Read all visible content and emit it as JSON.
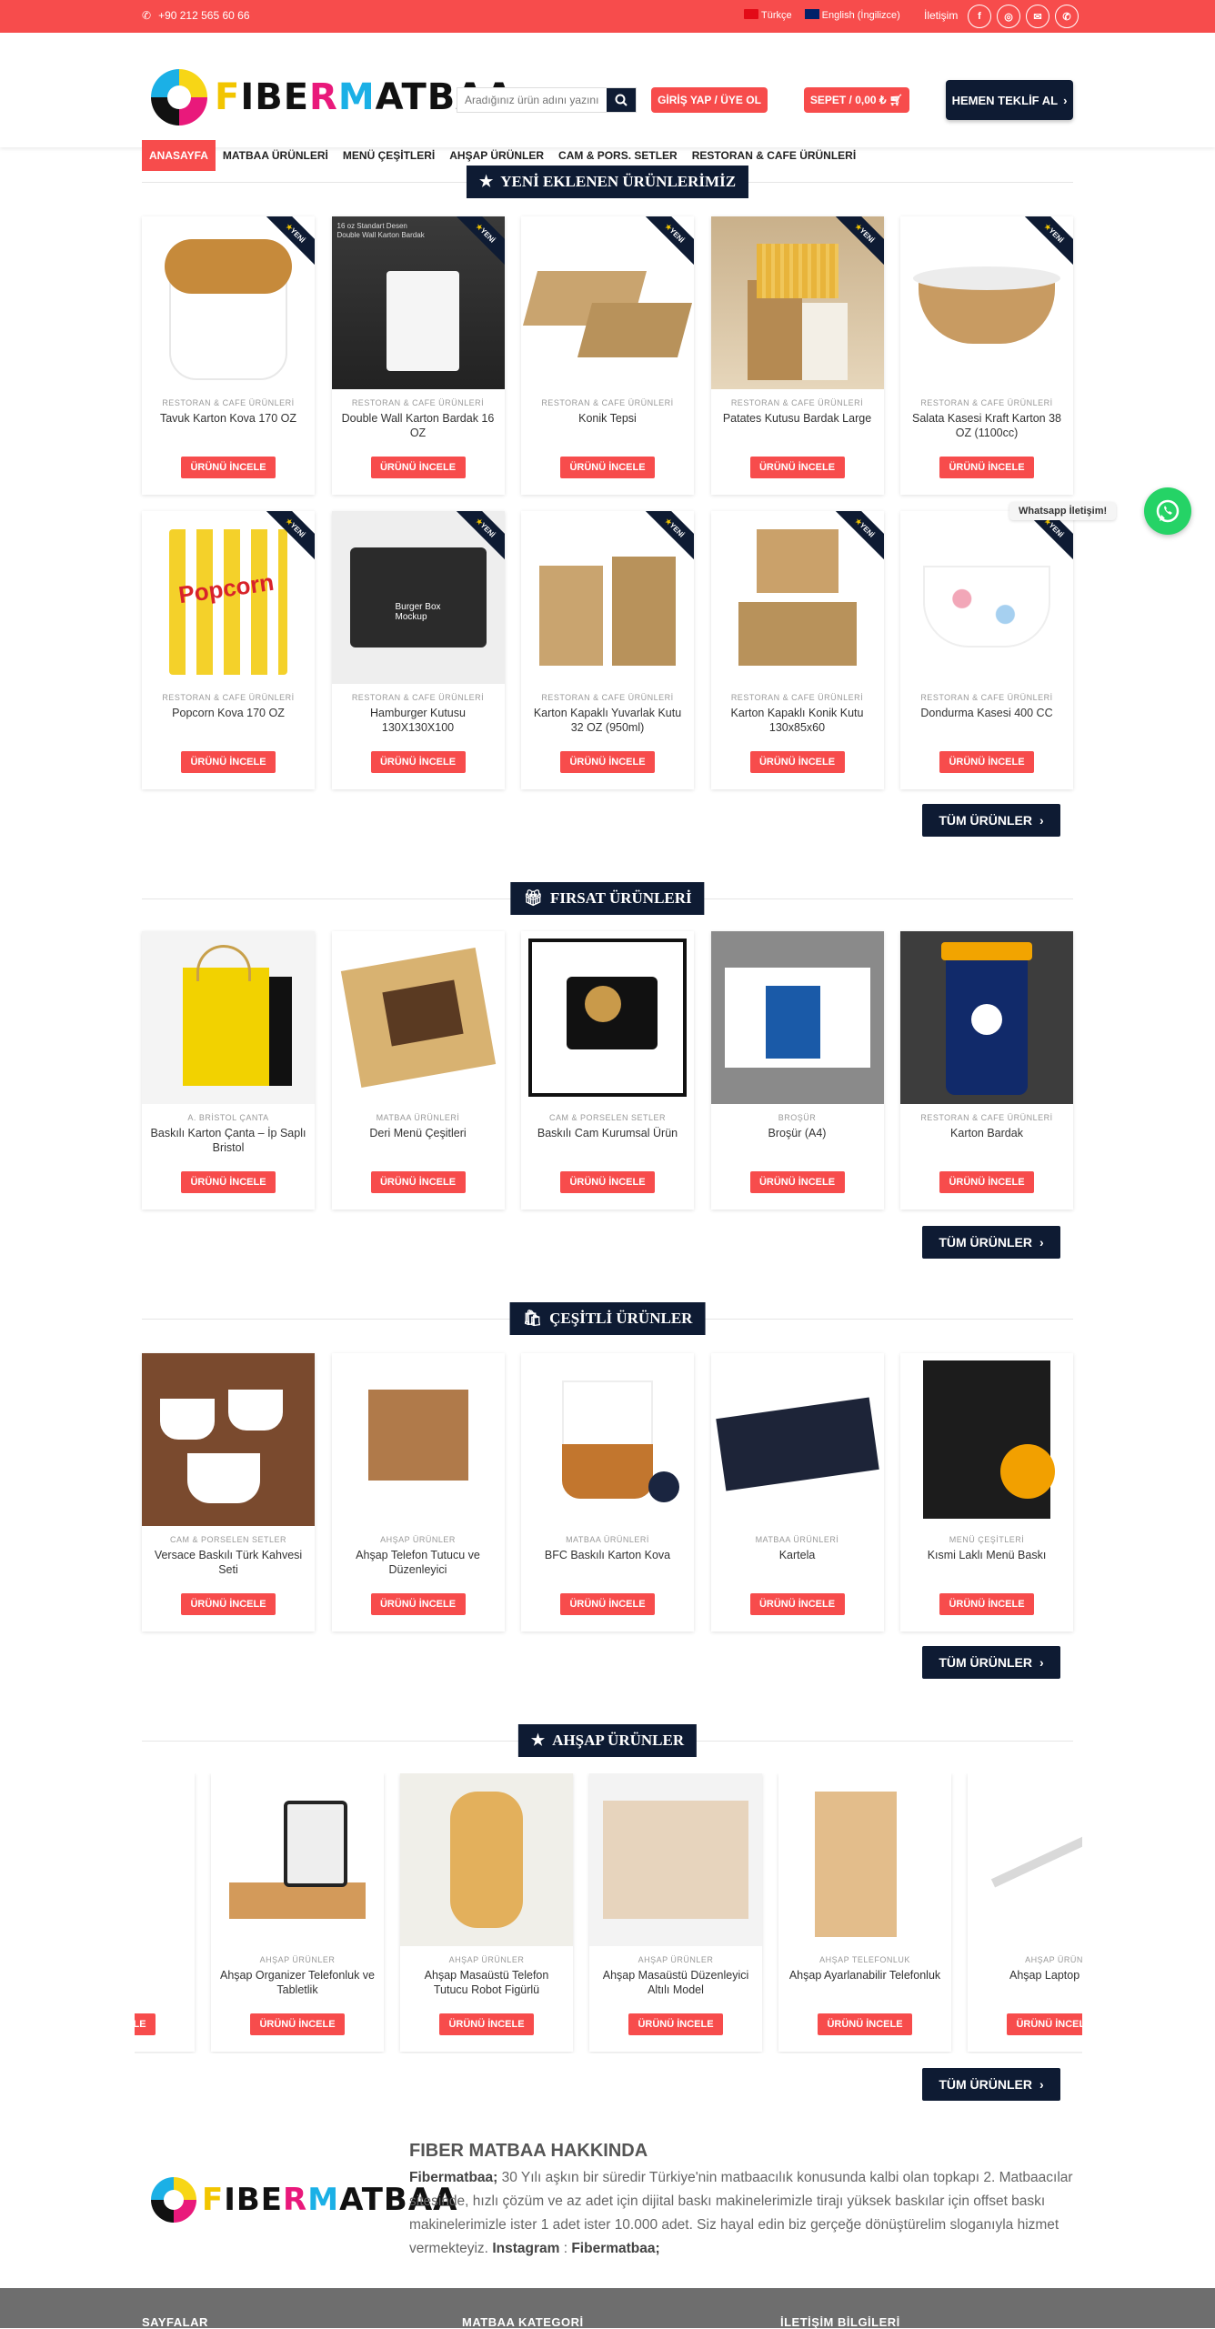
{
  "topbar": {
    "phone": "+90 212 565 60 66",
    "lang_tr": "Türkçe",
    "lang_en": "English (İngilizce)",
    "contact": "İletişim"
  },
  "header": {
    "logo": "FIBERMATBAA",
    "search_placeholder": "Aradığınız ürün adını yazını",
    "login": "GİRİŞ YAP / ÜYE OL",
    "cart": "SEPET / 0,00 ₺",
    "quote": "HEMEN TEKLİF AL"
  },
  "nav": [
    "ANASAYFA",
    "MATBAA ÜRÜNLERİ",
    "MENÜ ÇEŞİTLERİ",
    "AHŞAP ÜRÜNLER",
    "CAM & PORS. SETLER",
    "RESTORAN & CAFE ÜRÜNLERİ"
  ],
  "common": {
    "review_btn": "ÜRÜNÜ İNCELE",
    "all_products": "TÜM ÜRÜNLER",
    "new_badge": "YENİ"
  },
  "sections": {
    "new": {
      "title": "YENİ EKLENEN ÜRÜNLERİMİZ",
      "products": [
        {
          "cat": "RESTORAN & CAFE ÜRÜNLERİ",
          "name": "Tavuk Karton Kova 170 OZ"
        },
        {
          "cat": "RESTORAN & CAFE ÜRÜNLERİ",
          "name": "Double Wall Karton Bardak 16 OZ"
        },
        {
          "cat": "RESTORAN & CAFE ÜRÜNLERİ",
          "name": "Konik Tepsi"
        },
        {
          "cat": "RESTORAN & CAFE ÜRÜNLERİ",
          "name": "Patates Kutusu Bardak Large"
        },
        {
          "cat": "RESTORAN & CAFE ÜRÜNLERİ",
          "name": "Salata Kasesi Kraft Karton 38 OZ (1100cc)"
        },
        {
          "cat": "RESTORAN & CAFE ÜRÜNLERİ",
          "name": "Popcorn Kova 170 OZ"
        },
        {
          "cat": "RESTORAN & CAFE ÜRÜNLERİ",
          "name": "Hamburger Kutusu 130X130X100"
        },
        {
          "cat": "RESTORAN & CAFE ÜRÜNLERİ",
          "name": "Karton Kapaklı Yuvarlak Kutu 32 OZ (950ml)"
        },
        {
          "cat": "RESTORAN & CAFE ÜRÜNLERİ",
          "name": "Karton Kapaklı Konik Kutu 130x85x60"
        },
        {
          "cat": "RESTORAN & CAFE ÜRÜNLERİ",
          "name": "Dondurma Kasesi 400 CC"
        }
      ]
    },
    "deals": {
      "title": "FIRSAT ÜRÜNLERİ",
      "products": [
        {
          "cat": "A. BRİSTOL ÇANTA",
          "name": "Baskılı Karton Çanta – İp Saplı Bristol"
        },
        {
          "cat": "MATBAA ÜRÜNLERİ",
          "name": "Deri Menü Çeşitleri"
        },
        {
          "cat": "CAM & PORSELEN SETLER",
          "name": "Baskılı Cam Kurumsal Ürün"
        },
        {
          "cat": "BROŞÜR",
          "name": "Broşür (A4)"
        },
        {
          "cat": "RESTORAN & CAFE ÜRÜNLERİ",
          "name": "Karton Bardak"
        }
      ]
    },
    "misc": {
      "title": "ÇEŞİTLİ ÜRÜNLER",
      "products": [
        {
          "cat": "CAM & PORSELEN SETLER",
          "name": "Versace Baskılı Türk Kahvesi Seti"
        },
        {
          "cat": "AHŞAP ÜRÜNLER",
          "name": "Ahşap Telefon Tutucu ve Düzenleyici"
        },
        {
          "cat": "MATBAA ÜRÜNLERİ",
          "name": "BFC Baskılı Karton Kova"
        },
        {
          "cat": "MATBAA ÜRÜNLERİ",
          "name": "Kartela"
        },
        {
          "cat": "MENÜ ÇEŞİTLERİ",
          "name": "Kısmi Laklı Menü Baskı"
        }
      ]
    },
    "wood": {
      "title": "AHŞAP ÜRÜNLER",
      "products": [
        {
          "cat": "ER",
          "name": "alık"
        },
        {
          "cat": "AHŞAP ÜRÜNLER",
          "name": "Ahşap Organizer Telefonluk ve Tabletlik"
        },
        {
          "cat": "AHŞAP ÜRÜNLER",
          "name": "Ahşap Masaüstü Telefon Tutucu Robot Figürlü"
        },
        {
          "cat": "AHŞAP ÜRÜNLER",
          "name": "Ahşap Masaüstü Düzenleyici Altılı Model"
        },
        {
          "cat": "AHŞAP TELEFONLUK",
          "name": "Ahşap Ayarlanabilir Telefonluk"
        },
        {
          "cat": "AHŞAP ÜRÜN",
          "name": "Ahşap Laptop Tut"
        }
      ]
    }
  },
  "whatsapp": "Whatsapp İletişim!",
  "about": {
    "title": "FIBER MATBAA HAKKINDA",
    "brand": "Fibermatbaa;",
    "text": " 30 Yılı aşkın bir süredir Türkiye'nin matbaacılık konusunda kalbi olan topkapı 2. Matbaacılar sitesinde, hızlı çözüm ve az adet için dijital baskı makinelerimizle tirajı yüksek baskılar için offset baskı makinelerimizle ister 1 adet ister 10.000 adet. Siz hayal edin biz gerçeğe dönüştürelim sloganıyla hizmet vermekteyiz. ",
    "instagram_label": "Instagram",
    "instagram_sep": " : ",
    "instagram_value": "Fibermatbaa;"
  },
  "footer": {
    "col1": "SAYFALAR",
    "col2": "MATBAA KATEGORİ",
    "col3": "İLETİŞİM BİLGİLERİ"
  },
  "colors": {
    "accent": "#f74c4c",
    "navy": "#0e1b33"
  }
}
